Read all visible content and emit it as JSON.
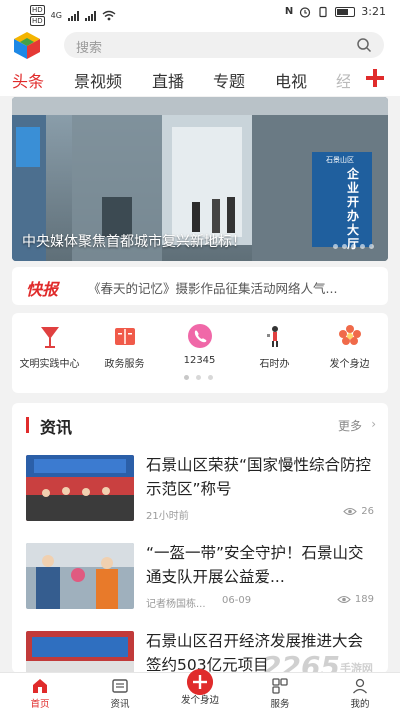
{
  "status_bar": {
    "left_badges": [
      "HD",
      "HD"
    ],
    "network": "4G",
    "time": "3:21"
  },
  "header": {
    "search_placeholder": "搜索"
  },
  "tabs": [
    {
      "label": "头条",
      "active": true
    },
    {
      "label": "景视频"
    },
    {
      "label": "直播"
    },
    {
      "label": "专题"
    },
    {
      "label": "电视"
    },
    {
      "label": "经"
    }
  ],
  "banner": {
    "caption": "中央媒体聚焦首都城市复兴新地标！",
    "sign_text": "企业开办大厅",
    "sign_header": "石景山区"
  },
  "flash": {
    "badge": "快报",
    "text": "《春天的记忆》摄影作品征集活动网络人气..."
  },
  "quick_links": [
    {
      "label": "文明实践中心",
      "icon": "flag-icon",
      "color": "#e04040"
    },
    {
      "label": "政务服务",
      "icon": "book-icon",
      "color": "#f05a4a"
    },
    {
      "label": "12345",
      "icon": "phone-icon",
      "color": "#f068a8"
    },
    {
      "label": "石时办",
      "icon": "figure-icon",
      "color": "#333333"
    },
    {
      "label": "发个身边",
      "icon": "flower-icon",
      "color": "#f06a4a"
    }
  ],
  "news": {
    "title": "资讯",
    "more": "更多",
    "items": [
      {
        "title": "石景山区荣获“国家慢性综合防控示范区”称号",
        "meta": "21小时前",
        "date": "",
        "views": "26"
      },
      {
        "title": "“一盔一带”安全守护！石景山交通支队开展公益爱...",
        "meta": "记者杨国栋...",
        "date": "06-09",
        "views": "189"
      },
      {
        "title": "石景山区召开经济发展推进大会 签约503亿元项目",
        "meta": "",
        "date": "",
        "views": ""
      }
    ]
  },
  "bottom_nav": [
    {
      "label": "首页",
      "active": true
    },
    {
      "label": "资讯"
    },
    {
      "label": "发个身边"
    },
    {
      "label": "服务"
    },
    {
      "label": "我的"
    }
  ],
  "watermark": {
    "brand": "2265",
    "suffix": "手游网"
  },
  "colors": {
    "accent": "#e02b2b"
  }
}
